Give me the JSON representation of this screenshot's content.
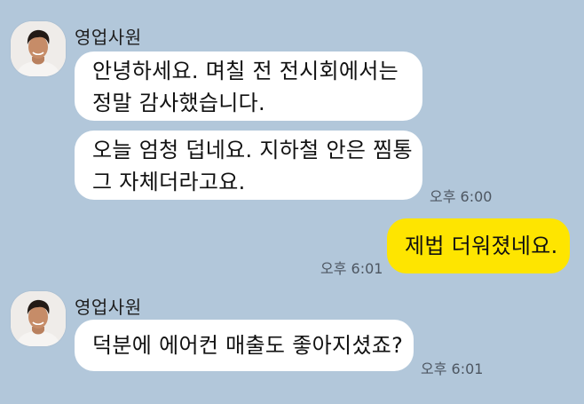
{
  "chat": {
    "groups": [
      {
        "sender": "영업사원",
        "messages": [
          {
            "lines": [
              "안녕하세요. 며칠 전 전시회에서는",
              "정말 감사했습니다."
            ]
          },
          {
            "lines": [
              "오늘 엄청 덥네요. 지하철 안은 찜통",
              "그 자체더라고요."
            ],
            "time": "오후 6:00"
          }
        ]
      },
      {
        "sender": "me",
        "messages": [
          {
            "lines": [
              "제법 더워졌네요."
            ],
            "time": "오후 6:01"
          }
        ]
      },
      {
        "sender": "영업사원",
        "messages": [
          {
            "lines": [
              "덕분에 에어컨 매출도 좋아지셨죠?"
            ],
            "time": "오후 6:01"
          }
        ]
      }
    ]
  },
  "colors": {
    "background": "#b2c7da",
    "incoming_bubble": "#ffffff",
    "outgoing_bubble": "#fee500"
  },
  "icons": {
    "avatar": "person-photo-icon"
  }
}
